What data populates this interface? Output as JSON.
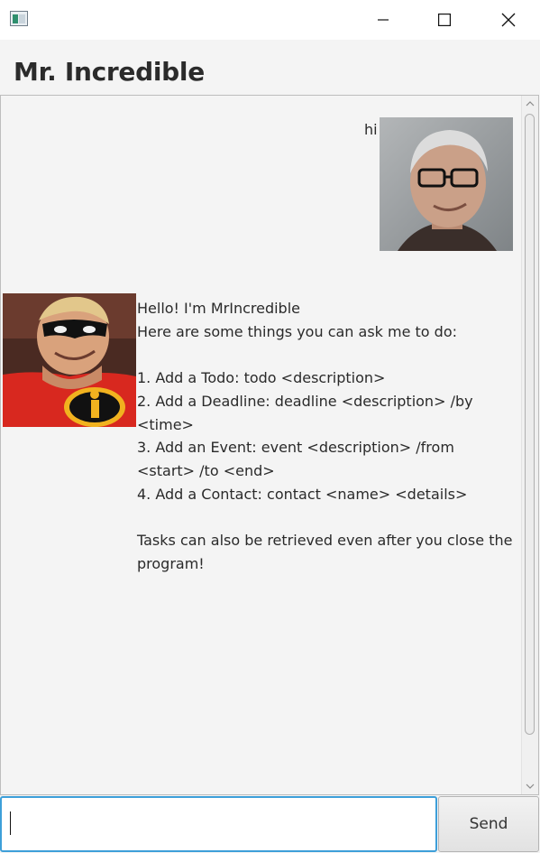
{
  "window": {
    "icon": "app-window-icon",
    "controls": [
      "minimize-icon",
      "maximize-icon",
      "close-icon"
    ]
  },
  "header": {
    "title": "Mr. Incredible"
  },
  "messages": [
    {
      "sender": "user",
      "avatar": "user-avatar",
      "text": "hi"
    },
    {
      "sender": "bot",
      "avatar": "mr-incredible-avatar",
      "text": "Hello! I'm MrIncredible\nHere are some things you can ask me to do:\n\n1. Add a Todo: todo <description>\n2. Add a Deadline: deadline <description> /by <time>\n3. Add an Event: event <description> /from <start> /to <end>\n4. Add a Contact: contact <name> <details>\n\nTasks can also be retrieved even after you close the program!"
    }
  ],
  "input": {
    "value": "",
    "placeholder": ""
  },
  "send_button": {
    "label": "Send"
  },
  "colors": {
    "accent": "#3d9fd9",
    "background": "#f4f4f4"
  }
}
